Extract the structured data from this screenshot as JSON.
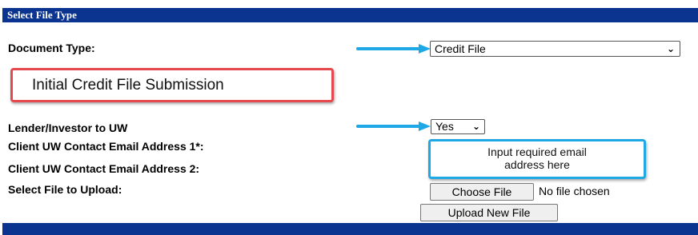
{
  "header": {
    "title": "Select File Type"
  },
  "form": {
    "document_type_label": "Document Type:",
    "document_type_value": "Credit File",
    "lender_investor_label": "Lender/Investor to UW",
    "lender_investor_value": "Yes",
    "email1_label": "Client UW Contact Email Address 1*:",
    "email2_label": "Client UW Contact Email Address 2:",
    "file_upload_label": "Select File to Upload:",
    "choose_file_button": "Choose File",
    "no_file_text": "No file chosen",
    "upload_button": "Upload New File"
  },
  "annotations": {
    "red_callout": "Initial Credit File Submission",
    "blue_callout_line1": "Input required email",
    "blue_callout_line2": "address here",
    "arrow_color": "#1fa8e6",
    "red_color": "#e5484d",
    "blue_color": "#1fa8e6"
  },
  "colors": {
    "header_bg": "#0a3490"
  },
  "icons": {
    "dropdown": "chevron-down-icon",
    "arrow": "arrow-right-icon"
  }
}
